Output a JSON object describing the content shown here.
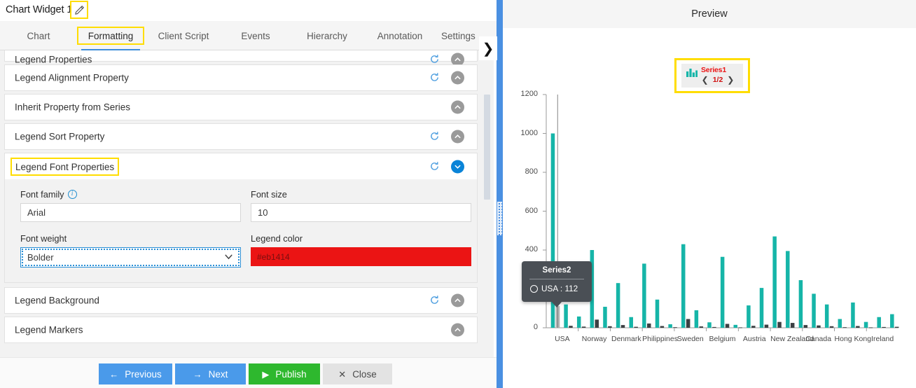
{
  "window": {
    "title": "Chart Widget 1",
    "edit_icon": "pencil-edit-icon",
    "help_icon": "?",
    "close_icon": "✕"
  },
  "tabs": {
    "items": [
      {
        "label": "Chart",
        "active": false
      },
      {
        "label": "Formatting",
        "active": true
      },
      {
        "label": "Client Script",
        "active": false
      },
      {
        "label": "Events",
        "active": false
      },
      {
        "label": "Hierarchy",
        "active": false
      },
      {
        "label": "Annotation",
        "active": false
      },
      {
        "label": "Settings",
        "active": false
      }
    ],
    "scroll_right_icon": "❯"
  },
  "accordion": {
    "rows": [
      {
        "label": "Legend Properties",
        "refresh": true,
        "expanded": false
      },
      {
        "label": "Legend Alignment Property",
        "refresh": true,
        "expanded": false
      },
      {
        "label": "Inherit Property from Series",
        "refresh": false,
        "expanded": false
      },
      {
        "label": "Legend Sort Property",
        "refresh": true,
        "expanded": false
      },
      {
        "label": "Legend Font Properties",
        "refresh": true,
        "expanded": true
      }
    ],
    "rows_after": [
      {
        "label": "Legend Background",
        "refresh": true,
        "expanded": false
      },
      {
        "label": "Legend Markers",
        "refresh": false,
        "expanded": false
      }
    ],
    "refresh_icon": "refresh-icon",
    "chevron_up_icon": "chevron-up-icon",
    "chevron_down_icon": "chevron-down-icon"
  },
  "font_form": {
    "font_family_label": "Font family",
    "font_family_value": "Arial",
    "font_family_info_icon": "info-icon",
    "font_size_label": "Font size",
    "font_size_value": "10",
    "font_weight_label": "Font weight",
    "font_weight_value": "Bolder",
    "legend_color_label": "Legend color",
    "legend_color_value": "#eb1414",
    "legend_color_swatch": "#eb1414"
  },
  "buttons": {
    "previous": {
      "label": "Previous",
      "icon": "←",
      "color": "#4a9aea"
    },
    "next": {
      "label": "Next",
      "icon": "→",
      "color": "#4a9aea"
    },
    "publish": {
      "label": "Publish",
      "icon": "▶",
      "color": "#2eb82e"
    },
    "close": {
      "label": "Close",
      "icon": "✕",
      "color": "#e3e3e3"
    }
  },
  "preview": {
    "title": "Preview",
    "legend": {
      "series_name": "Series1",
      "page_indicator": "1/2",
      "prev_arrow": "❮",
      "next_arrow": "❯",
      "icon": "bar-chart-icon",
      "text_color": "#eb1414"
    },
    "tooltip": {
      "title": "Series2",
      "value_text": "USA : 112",
      "marker": "circle-marker"
    }
  },
  "chart_data": {
    "type": "bar",
    "title": "",
    "xlabel": "",
    "ylabel": "",
    "ylim": [
      0,
      1200
    ],
    "yticks": [
      0,
      200,
      400,
      600,
      800,
      1000,
      1200
    ],
    "grid": false,
    "legend_position": "top",
    "categories": [
      "USA",
      "Norway",
      "Denmark",
      "Philippines",
      "Sweden",
      "Belgium",
      "Austria",
      "New Zealand",
      "Canada",
      "Hong Kong",
      "Ireland"
    ],
    "groups_per_category": 2,
    "series": [
      {
        "name": "Series1",
        "color": "#16b5a8",
        "values": [
          1000,
          120,
          58,
          400,
          108,
          230,
          55,
          330,
          145,
          18,
          430,
          90,
          28,
          365,
          15,
          115,
          205,
          470,
          395,
          245,
          175,
          120,
          45,
          130,
          30,
          55,
          70
        ]
      },
      {
        "name": "Series2",
        "color": "#3c4043",
        "values": [
          112,
          10,
          6,
          42,
          8,
          14,
          5,
          22,
          9,
          3,
          45,
          7,
          4,
          20,
          2,
          10,
          16,
          30,
          25,
          14,
          12,
          8,
          3,
          9,
          2,
          4,
          5
        ]
      }
    ]
  }
}
